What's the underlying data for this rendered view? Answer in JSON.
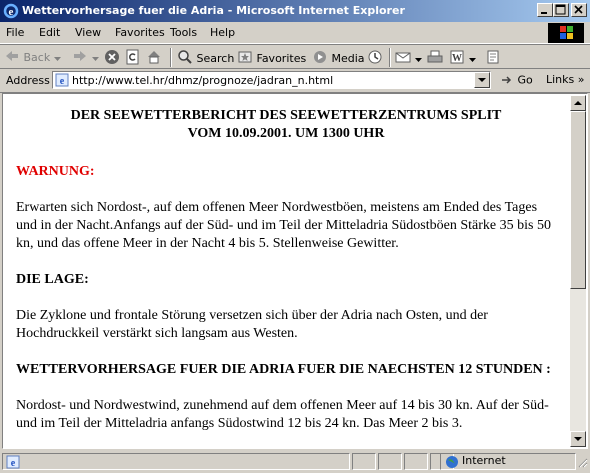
{
  "window": {
    "title": "Wettervorhersage fuer die Adria - Microsoft Internet Explorer"
  },
  "menubar": {
    "items": [
      "File",
      "Edit",
      "View",
      "Favorites",
      "Tools",
      "Help"
    ]
  },
  "toolbar": {
    "back_label": "Back",
    "search_label": "Search",
    "favorites_label": "Favorites",
    "media_label": "Media"
  },
  "address": {
    "label": "Address",
    "url": "http://www.tel.hr/dhmz/prognoze/jadran_n.html",
    "go_label": "Go",
    "links_label": "Links"
  },
  "page": {
    "heading_line1": "DER SEEWETTERBERICHT DES SEEWETTERZENTRUMS SPLIT",
    "heading_line2": "VOM 10.09.2001. UM 1300 UHR",
    "warning_title": "WARNUNG:",
    "warning_text": "Erwarten sich Nordost-, auf dem offenen Meer Nordwestböen, meistens am Ended des Tages und in der Nacht.Anfangs auf der Süd- und im Teil der Mitteladria Südostböen Stärke 35 bis 50 kn, und das offene Meer in der Nacht 4 bis 5. Stellenweise Gewitter.",
    "situation_title": "DIE LAGE:",
    "situation_text": "Die Zyklone und frontale Störung versetzen sich über der Adria nach Osten, und der Hochdruckkeil verstärkt sich langsam aus Westen.",
    "forecast_title": "WETTERVORHERSAGE FUER DIE ADRIA FUER DIE NAECHSTEN 12 STUNDEN :",
    "forecast_text": "Nordost- und Nordwestwind, zunehmend auf dem offenen Meer auf 14 bis 30 kn. Auf der Süd- und im Teil der Mitteladria anfangs Südostwind 12 bis 24 kn. Das Meer 2 bis 3."
  },
  "status": {
    "zone": "Internet"
  },
  "colors": {
    "warning": "#e00000",
    "titlebar_start": "#0a246a",
    "titlebar_end": "#a6caf0"
  }
}
